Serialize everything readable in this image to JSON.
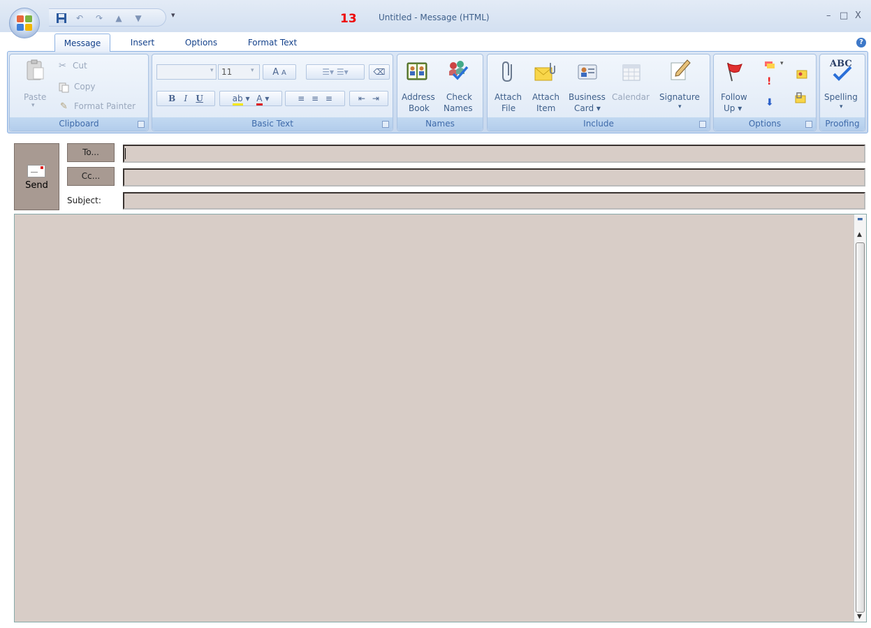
{
  "window": {
    "title": "Untitled - Message (HTML)",
    "step_number": "13",
    "controls": {
      "minimize": "–",
      "maximize": "□",
      "close": "X"
    }
  },
  "qat": {
    "more": "▾"
  },
  "tabs": [
    {
      "label": "Message",
      "active": true
    },
    {
      "label": "Insert"
    },
    {
      "label": "Options"
    },
    {
      "label": "Format Text"
    }
  ],
  "ribbon": {
    "clipboard": {
      "group_label": "Clipboard",
      "paste": "Paste",
      "cut": "Cut",
      "copy": "Copy",
      "format_painter": "Format Painter"
    },
    "basic_text": {
      "group_label": "Basic Text",
      "font_size": "11",
      "bold": "B",
      "italic": "I",
      "underline": "U",
      "grow_font": "A",
      "shrink_font": "A"
    },
    "names": {
      "group_label": "Names",
      "address_book": [
        "Address",
        "Book"
      ],
      "check_names": [
        "Check",
        "Names"
      ]
    },
    "include": {
      "group_label": "Include",
      "attach_file": [
        "Attach",
        "File"
      ],
      "attach_item": [
        "Attach",
        "Item"
      ],
      "business_card": [
        "Business",
        "Card ▾"
      ],
      "calendar": "Calendar",
      "signature": "Signature"
    },
    "options": {
      "group_label": "Options",
      "follow_up": [
        "Follow",
        "Up ▾"
      ]
    },
    "proofing": {
      "group_label": "Proofing",
      "spelling": "Spelling",
      "abc": "ABC"
    }
  },
  "compose": {
    "send": "Send",
    "to": "To...",
    "cc": "Cc...",
    "subject": "Subject:",
    "to_value": "",
    "cc_value": "",
    "subject_value": ""
  }
}
